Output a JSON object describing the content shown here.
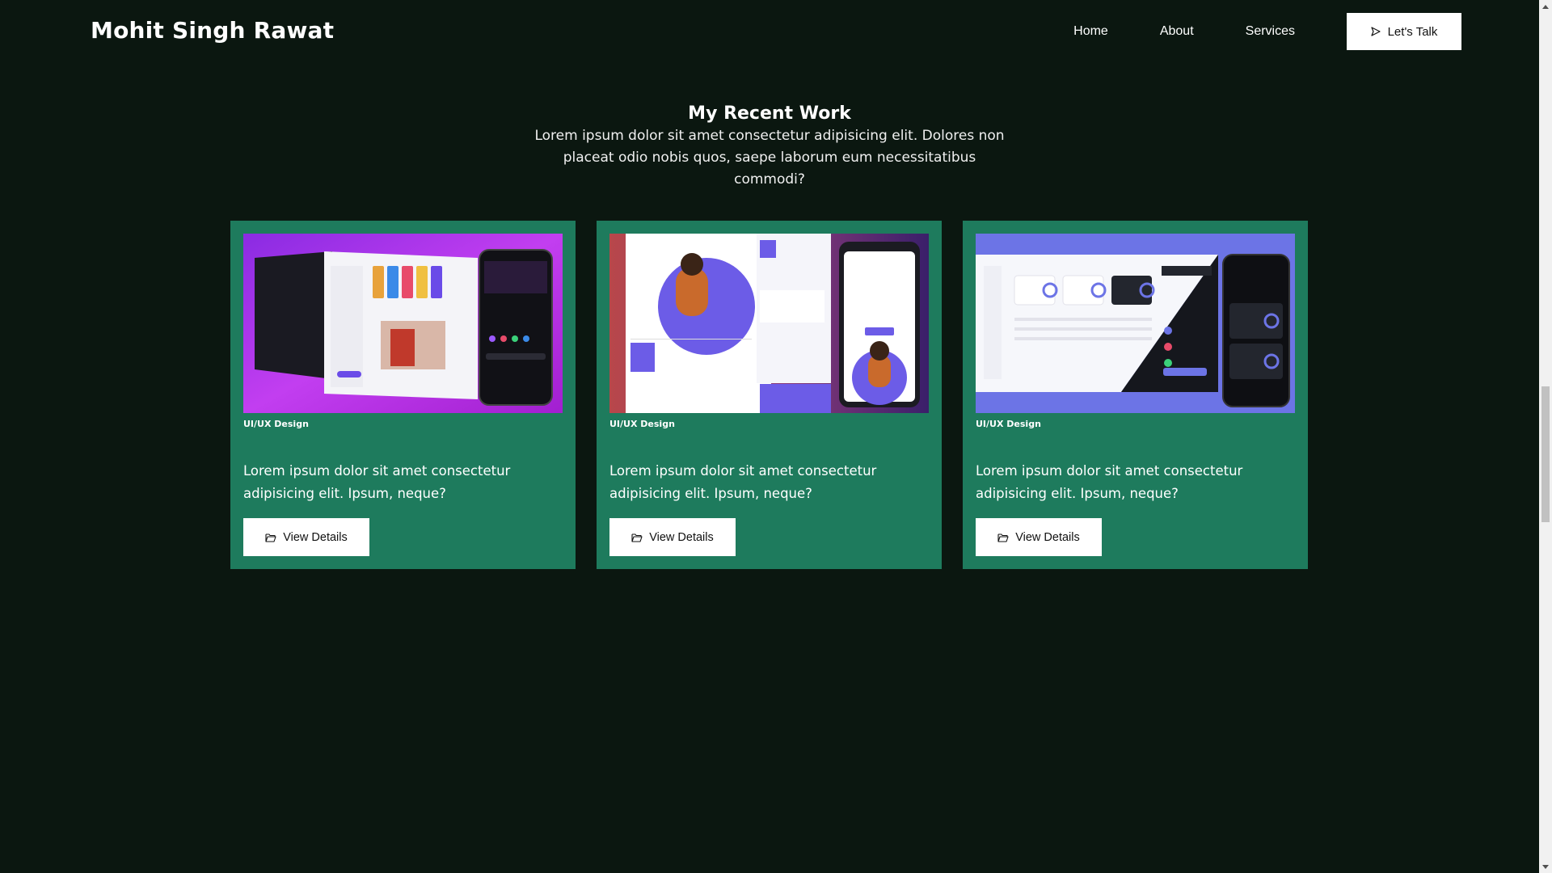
{
  "header": {
    "brand": "Mohit Singh Rawat",
    "nav": [
      "Home",
      "About",
      "Services"
    ],
    "cta_label": "Let's Talk"
  },
  "section": {
    "title": "My Recent Work",
    "subtitle": "Lorem ipsum dolor sit amet consectetur adipisicing elit. Dolores non placeat odio nobis quos, saepe laborum eum necessitatibus commodi?"
  },
  "cards": [
    {
      "tag": "UI/UX Design",
      "text": "Lorem ipsum dolor sit amet consectetur adipisicing elit. Ipsum, neque?",
      "button": "View Details",
      "thumbnail": "social-app-mockup"
    },
    {
      "tag": "UI/UX Design",
      "text": "Lorem ipsum dolor sit amet consectetur adipisicing elit. Ipsum, neque?",
      "button": "View Details",
      "thumbnail": "portfolio-site-mockup"
    },
    {
      "tag": "UI/UX Design",
      "text": "Lorem ipsum dolor sit amet consectetur adipisicing elit. Ipsum, neque?",
      "button": "View Details",
      "thumbnail": "dashboard-mockup"
    }
  ],
  "colors": {
    "background": "#0b1710",
    "card": "#1e7b5d",
    "button": "#ffffff"
  }
}
